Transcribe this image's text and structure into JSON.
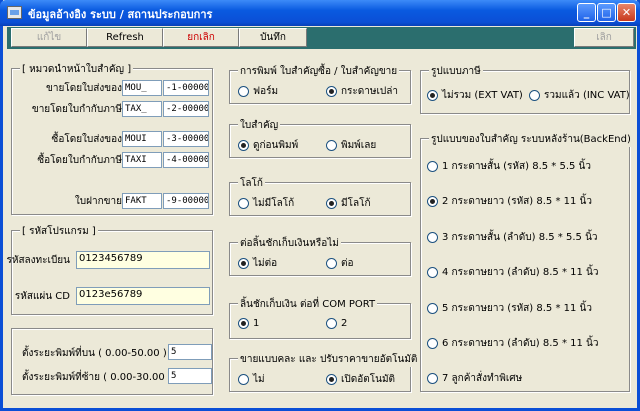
{
  "window": {
    "title": "ข้อมูลอ้างอิง ระบบ / สถานประกอบการ",
    "minimize_glyph": "_",
    "maximize_glyph": "□",
    "close_glyph": "✕"
  },
  "toolbar": {
    "edit_label": "แก้ไข",
    "refresh_label": "Refresh",
    "cancel_label": "ยกเลิก",
    "save_label": "บันทึก",
    "exit_label": "เลิก"
  },
  "prefix_group": {
    "title": "[ หมวดนำหน้าใบสำคัญ ]",
    "rows": [
      {
        "label": "ขายโดยใบส่งของ",
        "code": "MOU_",
        "number": "-1-000001"
      },
      {
        "label": "ขายโดยใบกำกับภาษี",
        "code": "TAX_",
        "number": "-2-000001"
      },
      {
        "label": "ซื้อโดยใบส่งของ",
        "code": "MOUI",
        "number": "-3-000001"
      },
      {
        "label": "ซื้อโดยใบกำกับภาษี",
        "code": "TAXI",
        "number": "-4-000001"
      },
      {
        "label": "ใบฝากขาย",
        "code": "FAKT",
        "number": "-9-000001"
      }
    ]
  },
  "program_code_group": {
    "title": "[ รหัสโปรแกรม ]",
    "registration_label": "รหัสลงทะเบียน",
    "registration_value": "0123456789",
    "cd_label": "รหัสแผ่น CD",
    "cd_value": "0123e56789"
  },
  "margins_group": {
    "top_label": "ตั้งระยะพิมพ์ที่บน ( 0.00-50.00 )",
    "top_value": "5",
    "left_label": "ตั้งระยะพิมพ์ที่ซ้าย ( 0.00-30.00 )",
    "left_value": "5"
  },
  "print_doc_group": {
    "title": "การพิมพ์ ใบสำคัญซื้อ / ใบสำคัญขาย",
    "option1": "ฟอร์ม",
    "option2": "กระดาษเปล่า",
    "selected": 2
  },
  "voucher_group": {
    "title": "ใบสำคัญ",
    "option1": "ดูก่อนพิมพ์",
    "option2": "พิมพ์เลย",
    "selected": 1
  },
  "logo_group": {
    "title": "โลโก้",
    "option1": "ไม่มีโลโก้",
    "option2": "มีโลโก้",
    "selected": 2
  },
  "drawer_group": {
    "title": "ต่อลิ้นชักเก็บเงินหรือไม่",
    "option1": "ไม่ต่อ",
    "option2": "ต่อ",
    "selected": 1
  },
  "port_group": {
    "title": "ลิ้นชักเก็บเงิน ต่อที่ COM PORT",
    "option1": "1",
    "option2": "2",
    "selected": 1
  },
  "auto_price_group": {
    "title": "ขายแบบคละ และ ปรับราคาขายอัตโนมัติ",
    "option1": "ไม่",
    "option2": "เปิดอัตโนมัติ",
    "selected": 2
  },
  "tax_group": {
    "title": "รูปแบบภาษี",
    "option1": "ไม่รวม (EXT VAT)",
    "option2": "รวมแล้ว (INC VAT)",
    "selected": 1
  },
  "backend_group": {
    "title": "รูปแบบของใบสำคัญ ระบบหลังร้าน(BackEnd)",
    "options": [
      "1  กระดาษสั้น (รหัส) 8.5 * 5.5 นิ้ว",
      "2  กระดาษยาว (รหัส) 8.5 * 11 นิ้ว",
      "3  กระดาษสั้น (ลำดับ) 8.5 * 5.5 นิ้ว",
      "4  กระดาษยาว (ลำดับ) 8.5 * 11 นิ้ว",
      "5  กระดาษยาว (รหัส) 8.5 * 11 นิ้ว",
      "6  กระดาษยาว (ลำดับ) 8.5 * 11 นิ้ว",
      "7  ลูกค้าสั่งทำพิเศษ"
    ],
    "selected": 2
  },
  "colors": {
    "titlebar": "#0b4fd6",
    "toolbar": "#2b6e6e",
    "window_bg": "#ece9d8",
    "field_highlight": "#ffffe1",
    "cancel_text": "#cc0000"
  }
}
